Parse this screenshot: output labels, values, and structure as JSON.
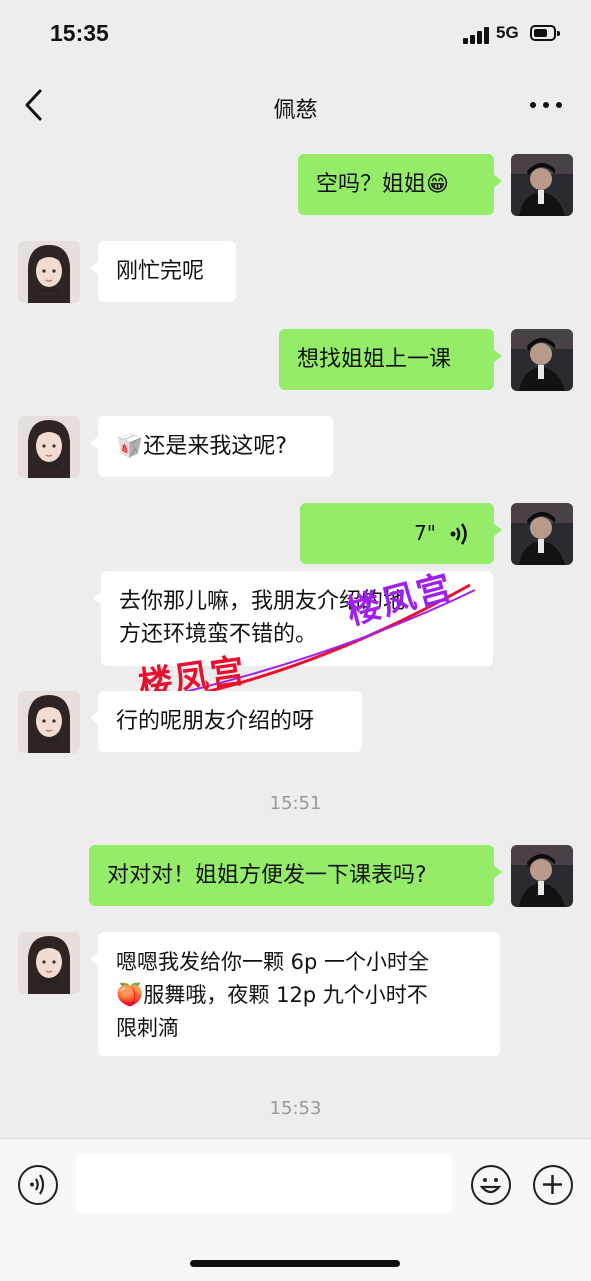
{
  "status_bar": {
    "time": "15:35",
    "network": "5G"
  },
  "header": {
    "title": "佩慈"
  },
  "messages": [
    {
      "side": "me",
      "text": "空吗？姐姐",
      "emoji": "😁"
    },
    {
      "side": "them",
      "text": "刚忙完呢"
    },
    {
      "side": "me",
      "text": "想找姐姐上一课"
    },
    {
      "side": "them",
      "emoji": "🥡",
      "text": "还是来我这呢?"
    },
    {
      "side": "me",
      "voice_duration": "7\""
    },
    {
      "side": "them",
      "line1": "去你那儿嘛，我朋友介绍的地",
      "line2": "方还环境蛮不错的。"
    },
    {
      "side": "them",
      "text": "行的呢朋友介绍的呀"
    },
    {
      "side": "me",
      "text": "对对对！姐姐方便发一下课表吗?"
    },
    {
      "side": "them",
      "line1": "嗯嗯我发给你一颗 6p 一个小时全",
      "line2_emoji": "🍑",
      "line2": "服舞哦，夜颗 12p 九个小时不",
      "line3": "限刺滴"
    }
  ],
  "timestamps": [
    "15:51",
    "15:53"
  ],
  "watermarks": [
    "楼凤宫",
    "楼凤宫"
  ],
  "input": {
    "placeholder": ""
  },
  "colors": {
    "background": "#ededed",
    "my_bubble": "#95ec69",
    "their_bubble": "#ffffff",
    "watermark_red": "#e8112d",
    "watermark_purple": "#a020f0"
  },
  "icons": [
    "back-chevron-icon",
    "more-dots-icon",
    "voice-mode-icon",
    "emoji-face-icon",
    "plus-icon",
    "voice-wave-icon"
  ]
}
